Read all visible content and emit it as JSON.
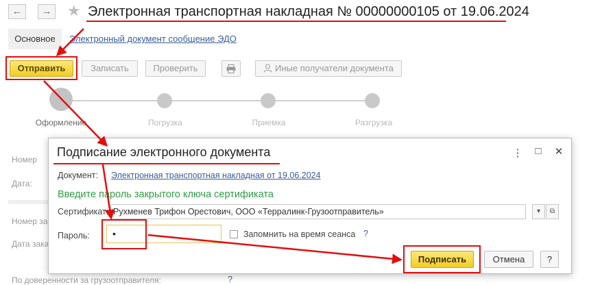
{
  "header": {
    "title": "Электронная транспортная накладная № 00000000105 от 19.06.2024",
    "back_icon": "arrow-left",
    "forward_icon": "arrow-right",
    "favorite_icon": "star"
  },
  "tabs": [
    {
      "label": "Основное"
    },
    {
      "label": "Электронный документ сообщение ЭДО"
    }
  ],
  "toolbar": {
    "send_label": "Отправить",
    "write_label": "Записать",
    "check_label": "Проверить",
    "print_icon": "printer",
    "recipients_label": "Иные получатели документа",
    "recipients_icon": "person"
  },
  "steps": [
    {
      "label": "Оформление",
      "active": true
    },
    {
      "label": "Погрузка",
      "active": false
    },
    {
      "label": "Приемка",
      "active": false
    },
    {
      "label": "Разгрузка",
      "active": false
    }
  ],
  "form": {
    "number_label": "Номер",
    "date_label": "Дата:",
    "order_number_label": "Номер за",
    "order_date_label": "Дата зака",
    "power_of_attorney_label": "По доверенности за грузоотправителя:",
    "help_mark": "?"
  },
  "dialog": {
    "title": "Подписание электронного документа",
    "menu_icon": "⋮",
    "maximize_icon": "□",
    "close_icon": "✕",
    "document_label": "Документ:",
    "document_link": "Электронная транспортная накладная от 19.06.2024",
    "hint": "Введите пароль закрытого ключа сертификата",
    "certificate_label": "Сертификат:",
    "certificate_value": "Рухменев Трифон Орестович, ООО «Терралинк-Грузоотправитель»",
    "password_label": "Пароль:",
    "password_value": "•",
    "remember_label": "Запомнить на время сеанса",
    "remember_checked": false,
    "help_mark": "?",
    "sign_label": "Подписать",
    "cancel_label": "Отмена",
    "help_label": "?"
  },
  "colors": {
    "accent_yellow": "#f3cd25",
    "annotation_red": "#e30d0d",
    "hint_green": "#2f9e44",
    "link_blue": "#3a5d9a"
  }
}
